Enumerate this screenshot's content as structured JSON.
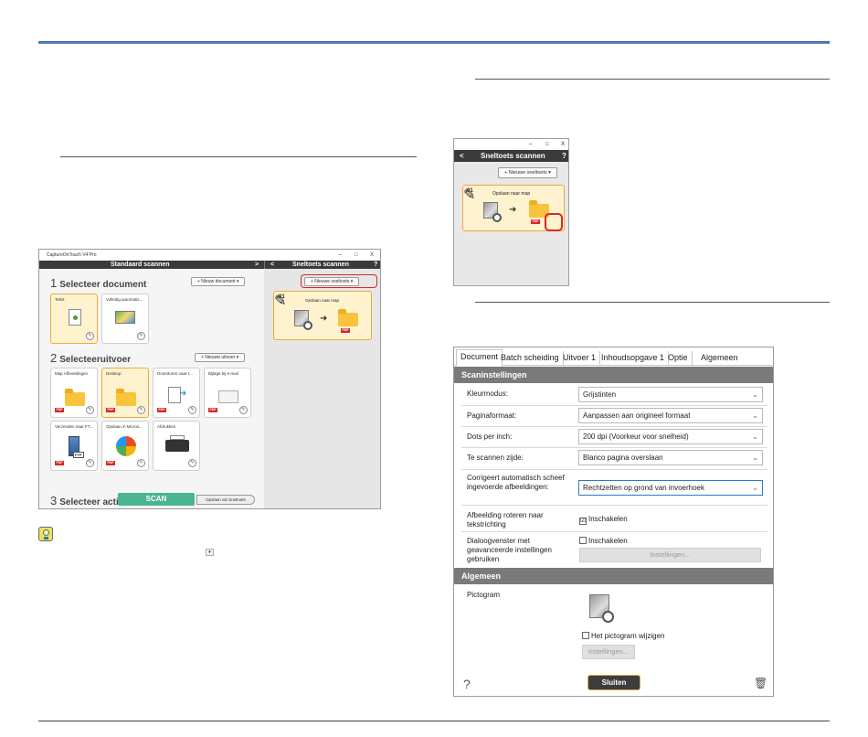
{
  "main_window": {
    "title": "CaptureOnTouch V4 Pro",
    "header_left": "Standaard scannen",
    "header_right": "Sneltoets scannen",
    "nav_next": ">",
    "nav_prev": "<",
    "help": "?",
    "minimize": "–",
    "maximize": "□",
    "close": "X",
    "step1": {
      "num": "1",
      "title": "Selecteer document",
      "button": "+ Nieuw document ▾"
    },
    "documents": [
      {
        "label": "Tekst",
        "selected": true
      },
      {
        "label": "Volledig automatis...",
        "selected": false
      }
    ],
    "step2": {
      "num": "2",
      "title": "Selecteeruitvoer",
      "button": "+ Nieuwe uitvoer ▾"
    },
    "outputs": [
      {
        "label": "Map Afbeeldingen",
        "pdf": "PDF"
      },
      {
        "label": "Desktop",
        "pdf": "PDF"
      },
      {
        "label": "Doorsturen naar t...",
        "pdf": "PDF"
      },
      {
        "label": "Bijlage bij e-mail",
        "pdf": "PDF"
      },
      {
        "label": "Verzenden naar FT...",
        "pdf": "PDF",
        "badge": "FTP"
      },
      {
        "label": "Opslaan in Micros...",
        "pdf": "PDF"
      },
      {
        "label": "Afdrukken",
        "pdf": ""
      }
    ],
    "step3": {
      "num": "3",
      "title": "Selecteer actie"
    },
    "scan_button": "SCAN",
    "save_shortcut_button": "Opslaan als Sneltoets",
    "new_shortcut_button": "+ Nieuwe sneltoets ▾",
    "shortcut": {
      "index": "01",
      "label": "Opslaan naar map",
      "pdf": "PDF"
    }
  },
  "popup_window": {
    "title": "Sneltoets scannen",
    "back": "<",
    "help": "?",
    "minimize": "–",
    "maximize": "□",
    "close": "X",
    "new_shortcut_button": "+ Nieuwe sneltoets ▾",
    "shortcut": {
      "index": "01",
      "label": "Opslaan naar map",
      "pdf": "PDF"
    }
  },
  "dialog": {
    "tabs": [
      "Document",
      "Batch scheiding",
      "Uitvoer 1",
      "Inhoudsopgave 1",
      "Optie",
      "Algemeen"
    ],
    "active_tab": 0,
    "section_scan": "Scaninstellingen",
    "rows": [
      {
        "label": "Kleurmodus:",
        "value": "Grijstinten"
      },
      {
        "label": "Paginaformaat:",
        "value": "Aanpassen aan origineel formaat"
      },
      {
        "label": "Dots per inch:",
        "value": "200 dpi (Voorkeur voor snelheid)"
      },
      {
        "label": "Te scannen zijde:",
        "value": "Blanco pagina overslaan"
      },
      {
        "label": "Corrigeert automatisch scheef ingevoerde afbeeldingen:",
        "value": "Rechtzetten op grond van invoerhoek"
      }
    ],
    "rotate": {
      "label": "Afbeelding roteren naar tekstrichting",
      "checkbox": "Inschakelen",
      "checked": "☑"
    },
    "advanced": {
      "label": "Dialoogvenster met geavanceerde instellingen gebruiken",
      "checkbox": "Inschakelen",
      "checked": "",
      "button": "Instellingen..."
    },
    "section_general": "Algemeen",
    "pictogram": {
      "label": "Pictogram",
      "checkbox": "Het pictogram wijzigen",
      "button": "Instellingen..."
    },
    "help": "?",
    "close_button": "Sluiten",
    "trash": "🗑"
  },
  "tip_dropdown": "▾"
}
